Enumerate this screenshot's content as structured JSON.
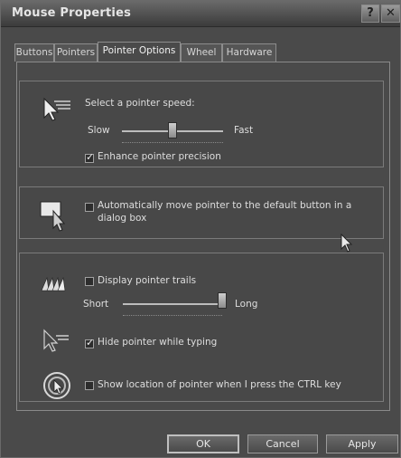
{
  "window": {
    "title": "Mouse Properties",
    "help_button": "?",
    "close_button": "✕"
  },
  "tabs": [
    {
      "label": "Buttons",
      "active": false
    },
    {
      "label": "Pointers",
      "active": false
    },
    {
      "label": "Pointer Options",
      "active": true
    },
    {
      "label": "Wheel",
      "active": false
    },
    {
      "label": "Hardware",
      "active": false
    }
  ],
  "motion": {
    "speed_label": "Select a pointer speed:",
    "slow_label": "Slow",
    "fast_label": "Fast",
    "speed_level": 0.5,
    "enhance_label": "Enhance pointer precision",
    "enhance_checked": true
  },
  "snapto": {
    "label_line1": "Automatically move pointer to the default button in a",
    "label_line2": "dialog box",
    "checked": false
  },
  "visibility": {
    "trails_label": "Display pointer trails",
    "trails_checked": false,
    "short_label": "Short",
    "long_label": "Long",
    "trails_level": 1.0,
    "hide_label": "Hide pointer while typing",
    "hide_checked": true,
    "ctrl_label": "Show location of pointer when I press the CTRL key",
    "ctrl_checked": false
  },
  "buttons": {
    "ok": "OK",
    "cancel": "Cancel",
    "apply": "Apply"
  },
  "colors": {
    "window_bg": "#4a4a4a",
    "text": "#dedede",
    "border": "#8a8a8a"
  }
}
